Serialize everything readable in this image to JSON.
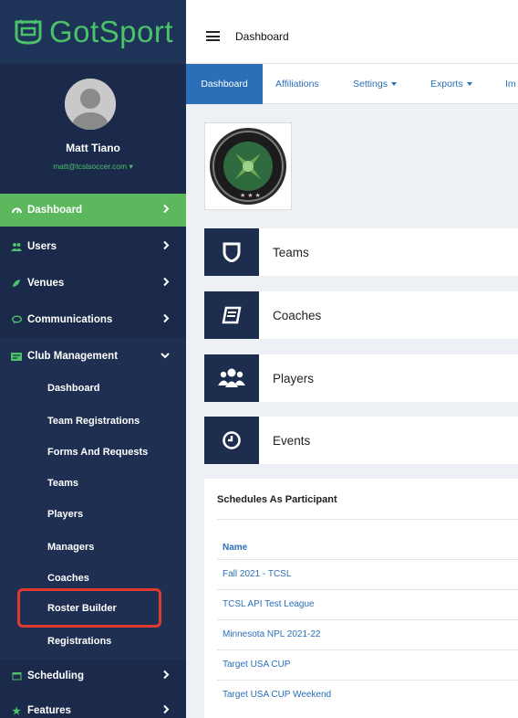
{
  "brand": {
    "name": "GotSport",
    "accent": "#4bc26a"
  },
  "user": {
    "name": "Matt Tiano",
    "email": "matt@tcslsoccer.com"
  },
  "nav": [
    {
      "label": "Dashboard",
      "icon": "dashboard-icon",
      "active": true
    },
    {
      "label": "Users",
      "icon": "users-icon"
    },
    {
      "label": "Venues",
      "icon": "venues-icon"
    },
    {
      "label": "Communications",
      "icon": "chat-icon"
    },
    {
      "label": "Club Management",
      "icon": "club-icon",
      "expanded": true
    },
    {
      "label": "Scheduling",
      "icon": "calendar-icon"
    },
    {
      "label": "Features",
      "icon": "star-icon"
    }
  ],
  "club_submenu": [
    "Dashboard",
    "Team Registrations",
    "Forms And Requests",
    "Teams",
    "Players",
    "Managers",
    "Coaches",
    "Roster Builder",
    "Registrations"
  ],
  "topbar": {
    "title": "Dashboard"
  },
  "tabs": [
    {
      "label": "Dashboard",
      "active": true
    },
    {
      "label": "Affiliations"
    },
    {
      "label": "Settings",
      "dropdown": true
    },
    {
      "label": "Exports",
      "dropdown": true
    },
    {
      "label": "Im"
    }
  ],
  "cards": [
    {
      "label": "Teams",
      "icon": "shield-icon"
    },
    {
      "label": "Coaches",
      "icon": "book-icon"
    },
    {
      "label": "Players",
      "icon": "players-icon"
    },
    {
      "label": "Events",
      "icon": "clock-icon"
    }
  ],
  "schedules": {
    "title": "Schedules As Participant",
    "column": "Name",
    "rows": [
      "Fall 2021 - TCSL",
      "TCSL API Test League",
      "Minnesota NPL 2021-22",
      "Target USA CUP",
      "Target USA CUP Weekend"
    ]
  },
  "colors": {
    "sidebar": "#1b2a4a",
    "active_nav": "#5cb85c",
    "link": "#2a6fb7",
    "highlight": "#e03a32"
  }
}
